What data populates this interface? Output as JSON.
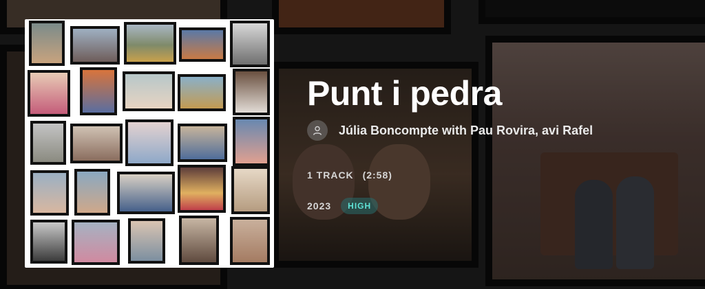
{
  "album": {
    "title": "Punt i pedra",
    "artist": "Júlia Boncompte with Pau Rovira, avi Rafel",
    "tracks": "1 TRACK",
    "duration": "(2:58)",
    "year": "2023",
    "quality_badge": "HIGH"
  },
  "colors": {
    "badge_text": "#5fe3d6",
    "badge_bg": "#2a6e6e",
    "background": "#1b1b1b"
  },
  "icons": {
    "artist_avatar": "user-icon"
  }
}
